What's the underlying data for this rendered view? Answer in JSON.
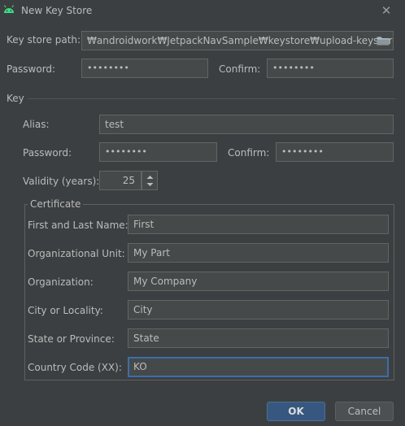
{
  "window": {
    "title": "New Key Store"
  },
  "keystore": {
    "path_label": "Key store path:",
    "path_value": "₩androidwork₩JetpackNavSample₩keystore₩upload-keystore.jks",
    "password_label": "Password:",
    "password_value": "••••••••",
    "confirm_label": "Confirm:",
    "confirm_value": "••••••••"
  },
  "key": {
    "section_label": "Key",
    "alias_label": "Alias:",
    "alias_value": "test",
    "password_label": "Password:",
    "password_value": "••••••••",
    "confirm_label": "Confirm:",
    "confirm_value": "••••••••",
    "validity_label": "Validity (years):",
    "validity_value": "25"
  },
  "certificate": {
    "legend": "Certificate",
    "fields": [
      {
        "label": "First and Last Name:",
        "value": "First"
      },
      {
        "label": "Organizational Unit:",
        "value": "My Part"
      },
      {
        "label": "Organization:",
        "value": "My Company"
      },
      {
        "label": "City or Locality:",
        "value": "City"
      },
      {
        "label": "State or Province:",
        "value": "State"
      },
      {
        "label": "Country Code (XX):",
        "value": "KO"
      }
    ]
  },
  "buttons": {
    "ok": "OK",
    "cancel": "Cancel"
  },
  "colors": {
    "background": "#3c3f41",
    "field": "#45494a",
    "accent": "#365880",
    "focus": "#3d6ea8",
    "android": "#3ddc84"
  }
}
